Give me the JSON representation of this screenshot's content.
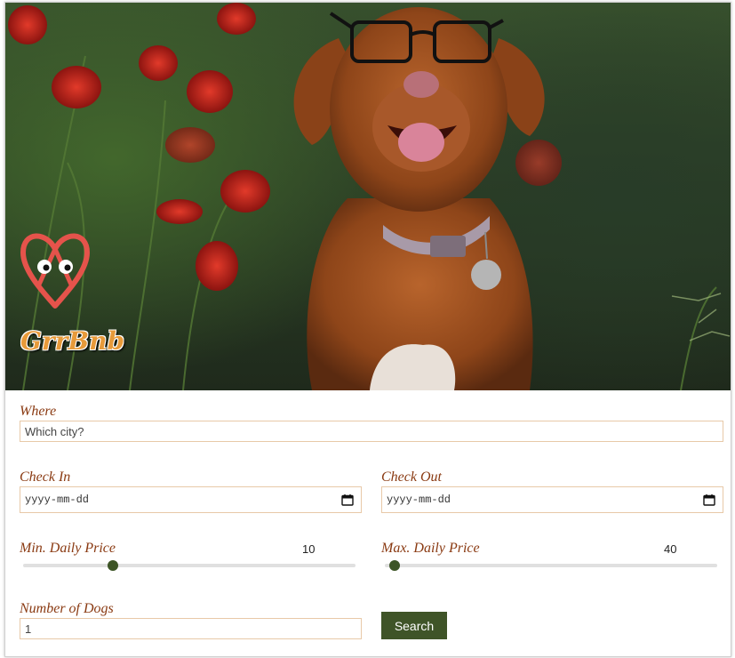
{
  "brand": {
    "name": "GrrBnb",
    "accent": "#e5534b",
    "text_color": "#e79a3a"
  },
  "hero": {
    "image": "dog-in-poppy-field"
  },
  "form": {
    "where": {
      "label": "Where",
      "placeholder": "Which city?"
    },
    "check_in": {
      "label": "Check In",
      "placeholder": "yyyy-mm-dd",
      "icon": "calendar-icon"
    },
    "check_out": {
      "label": "Check Out",
      "placeholder": "yyyy-mm-dd",
      "icon": "calendar-icon"
    },
    "min_price": {
      "label": "Min. Daily Price",
      "value": "10",
      "level": 0.27
    },
    "max_price": {
      "label": "Max. Daily Price",
      "value": "40",
      "level": 0.03
    },
    "dogs": {
      "label": "Number of Dogs",
      "value": "1"
    },
    "search_label": "Search"
  },
  "colors": {
    "label": "#8a3a12",
    "button": "#3f5428",
    "input_border": "#e8c9a8"
  }
}
